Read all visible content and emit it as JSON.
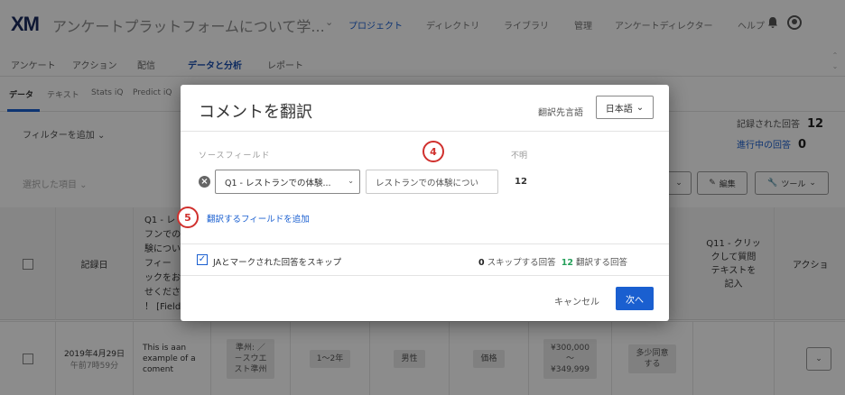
{
  "header": {
    "logo": "XM",
    "survey_title": "アンケートプラットフォームについて学...",
    "nav": [
      "プロジェクト",
      "ディレクトリ",
      "ライブラリ",
      "管理",
      "アンケートディレクター",
      "ヘルプ"
    ],
    "active_nav": "プロジェクト"
  },
  "subnav": {
    "items": [
      "アンケート",
      "アクション",
      "配信",
      "データと分析",
      "レポート"
    ],
    "active": "データと分析"
  },
  "tabs": {
    "items": [
      "データ",
      "テキスト",
      "Stats iQ",
      "Predict iQ"
    ],
    "active": "データ"
  },
  "toolbar": {
    "filter": "フィルターを追加 ⌄",
    "recorded_label": "記録された回答",
    "recorded_count": "12",
    "inprogress_label": "進行中の回答",
    "inprogress_count": "0",
    "selected": "選択した項目 ⌄",
    "edit_label": "編集",
    "tools_label": "ツール"
  },
  "table": {
    "head": {
      "date": "記録日",
      "q1": "Q1 - レ\nフンでの\n験につい\nフィー\nックをお\nせくださ\n！ [Field",
      "q11": "Q11 - クリッ\nクして質問\nテキストを\n記入",
      "action": "アクショ"
    },
    "row": {
      "date": "2019年4月29日",
      "time": "午前7時59分",
      "comment": "This is aan\nexample of a\ncoment",
      "pref": "準州: ／\n－スウエ\nスト準州",
      "years": "1～2年",
      "gender": "男性",
      "factor": "価格",
      "income": "¥300,000\n～\n¥349,999",
      "agree": "多少同意\nする"
    }
  },
  "modal": {
    "title": "コメントを翻訳",
    "lang_label": "翻訳先言語",
    "lang_value": "日本語",
    "source_label": "ソースフィールド",
    "unknown_label": "不明",
    "field_select": "Q1 - レストランでの体験...",
    "field_input": "レストランでの体験につい",
    "count": "12",
    "add_link": "翻訳するフィールドを追加",
    "skip_label": "JAとマークされた回答をスキップ",
    "skip_checked": true,
    "skip_count": "0",
    "skip_text": "スキップする回答",
    "translate_count": "12",
    "translate_text": "翻訳する回答",
    "cancel": "キャンセル",
    "next": "次へ"
  },
  "badges": [
    "4",
    "5"
  ]
}
